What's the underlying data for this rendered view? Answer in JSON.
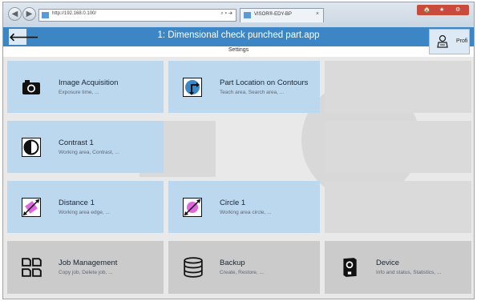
{
  "browser": {
    "address": "http://192.168.0.100/",
    "address_controls": "⌕ ▾ ➔",
    "tab_title": "VISOR®-EDY-BP",
    "tab_close": "×",
    "back_glyph": "◀",
    "forward_glyph": "▶",
    "window_controls": [
      "🏠",
      "★",
      "⚙"
    ]
  },
  "app": {
    "title": "1: Dimensional check punched part.app",
    "subtitle": "Settings",
    "back_glyph": "🡐",
    "profile_label": "Profi"
  },
  "tiles": [
    {
      "title": "Image Acquisition",
      "sub": "Exposure time, ..."
    },
    {
      "title": "Part Location on Contours",
      "sub": "Teach area, Search area, ..."
    },
    {
      "title": "Contrast 1",
      "sub": "Working area, Contrast, ..."
    },
    {
      "title": "Distance 1",
      "sub": "Working area edge, ..."
    },
    {
      "title": "Circle 1",
      "sub": "Working area circle, ..."
    },
    {
      "title": "Job Management",
      "sub": "Copy job, Delete job, ..."
    },
    {
      "title": "Backup",
      "sub": "Create, Restore, ..."
    },
    {
      "title": "Device",
      "sub": "Info and status, Statistics, ..."
    }
  ],
  "colors": {
    "accent": "#3d86c5",
    "tile_blue": "#bcd8ef",
    "tile_grey": "#cbcbcb",
    "distance_pink": "#e066e0"
  }
}
